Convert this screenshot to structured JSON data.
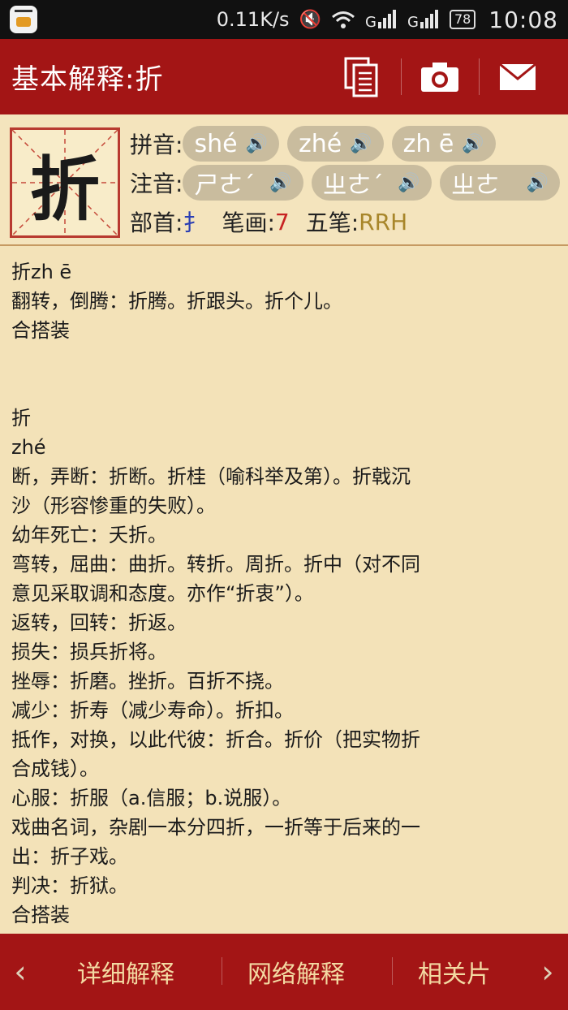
{
  "status_bar": {
    "net_speed": "0.11K/s",
    "battery": "78",
    "time": "10:08",
    "icons": [
      "app-icon",
      "mute-icon",
      "wifi-icon",
      "signal-icon",
      "signal-icon",
      "battery-icon"
    ]
  },
  "header": {
    "title": "基本解释:折",
    "icons": [
      "copy-icon",
      "camera-icon",
      "mail-icon"
    ]
  },
  "character": {
    "glyph": "折",
    "pinyin_label": "拼音:",
    "pinyin": [
      "shé",
      "zhé",
      "zh ē"
    ],
    "zhuyin_label": "注音:",
    "zhuyin": [
      "ㄕㄜˊ",
      "ㄓㄜˊ",
      "ㄓㄜ"
    ],
    "radical_label": "部首:",
    "radical": "扌",
    "strokes_label": "笔画:",
    "strokes": "7",
    "wubi_label": "五笔:",
    "wubi": "RRH"
  },
  "content": {
    "lines": [
      "折zh ē",
      "翻转，倒腾：折腾。折跟头。折个儿。",
      "合搭装",
      "",
      "折",
      "zhé",
      "断，弄断：折断。折桂（喻科举及第）。折戟沉",
      "沙（形容惨重的失败）。",
      "幼年死亡：夭折。",
      "弯转，屈曲：曲折。转折。周折。折中（对不同",
      "意见采取调和态度。亦作“折衷”）。",
      "返转，回转：折返。",
      "损失：损兵折将。",
      "挫辱：折磨。挫折。百折不挠。",
      "减少：折寿（减少寿命）。折扣。",
      "抵作，对换，以此代彼：折合。折价（把实物折",
      "合成钱）。",
      "心服：折服（a.信服；b.说服）。",
      "戏曲名词，杂剧一本分四折，一折等于后来的一",
      "出：折子戏。",
      "判决：折狱。",
      "合搭装"
    ]
  },
  "bottom_nav": {
    "prev": "‹",
    "next": "›",
    "tabs": [
      "详细解释",
      "网络解释",
      "相关片"
    ]
  },
  "colors": {
    "header_red": "#a31515",
    "background": "#f3e2b8",
    "pill": "#c9bc9e"
  }
}
